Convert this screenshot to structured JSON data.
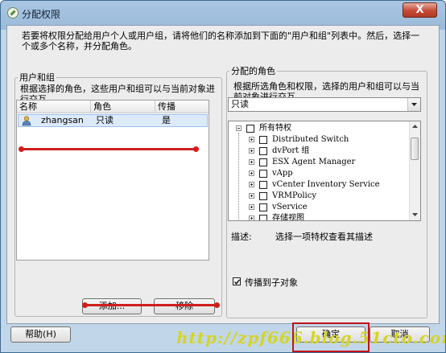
{
  "window": {
    "title": "分配权限",
    "close_label": "X"
  },
  "intro_text": "若要将权限分配给用户个人或用户组，请将他们的名称添加到下面的\"用户和组\"列表中。然后，选择一个或多个名称，并分配角色。",
  "users_group": {
    "title": "用户和组",
    "description": "根据选择的角色，这些用户和组可以与当前对象进行交互。",
    "columns": [
      "名称",
      "角色",
      "传播"
    ],
    "rows": [
      {
        "name": "zhangsan",
        "role": "只读",
        "propagate": "是"
      }
    ],
    "add_label": "添加...",
    "remove_label": "移除"
  },
  "assigned_role": {
    "title": "分配的角色",
    "description": "根据所选角色和权限，选择的用户和组可以与当前对象进行交互。",
    "selected_role": "只读",
    "tree": [
      {
        "label": "所有特权",
        "level": 0,
        "expanded": true
      },
      {
        "label": "Distributed Switch",
        "level": 1
      },
      {
        "label": "dvPort 组",
        "level": 1
      },
      {
        "label": "ESX Agent Manager",
        "level": 1
      },
      {
        "label": "vApp",
        "level": 1
      },
      {
        "label": "vCenter Inventory Service",
        "level": 1
      },
      {
        "label": "VRMPolicy",
        "level": 1
      },
      {
        "label": "vService",
        "level": 1
      },
      {
        "label": "存储视图",
        "level": 1
      }
    ],
    "description_label": "描述:",
    "description_text": "选择一项特权查看其描述",
    "propagate_label": "传播到子对象",
    "propagate_checked": true
  },
  "footer": {
    "help_label": "帮助(H)",
    "ok_label": "确定",
    "cancel_label": "取消"
  },
  "watermark": "http://zpf666.blog.51cto.com/",
  "colors": {
    "annotation_red": "#d01d1d",
    "watermark": "#d4d429",
    "title_bar": "#a9c6e2"
  }
}
